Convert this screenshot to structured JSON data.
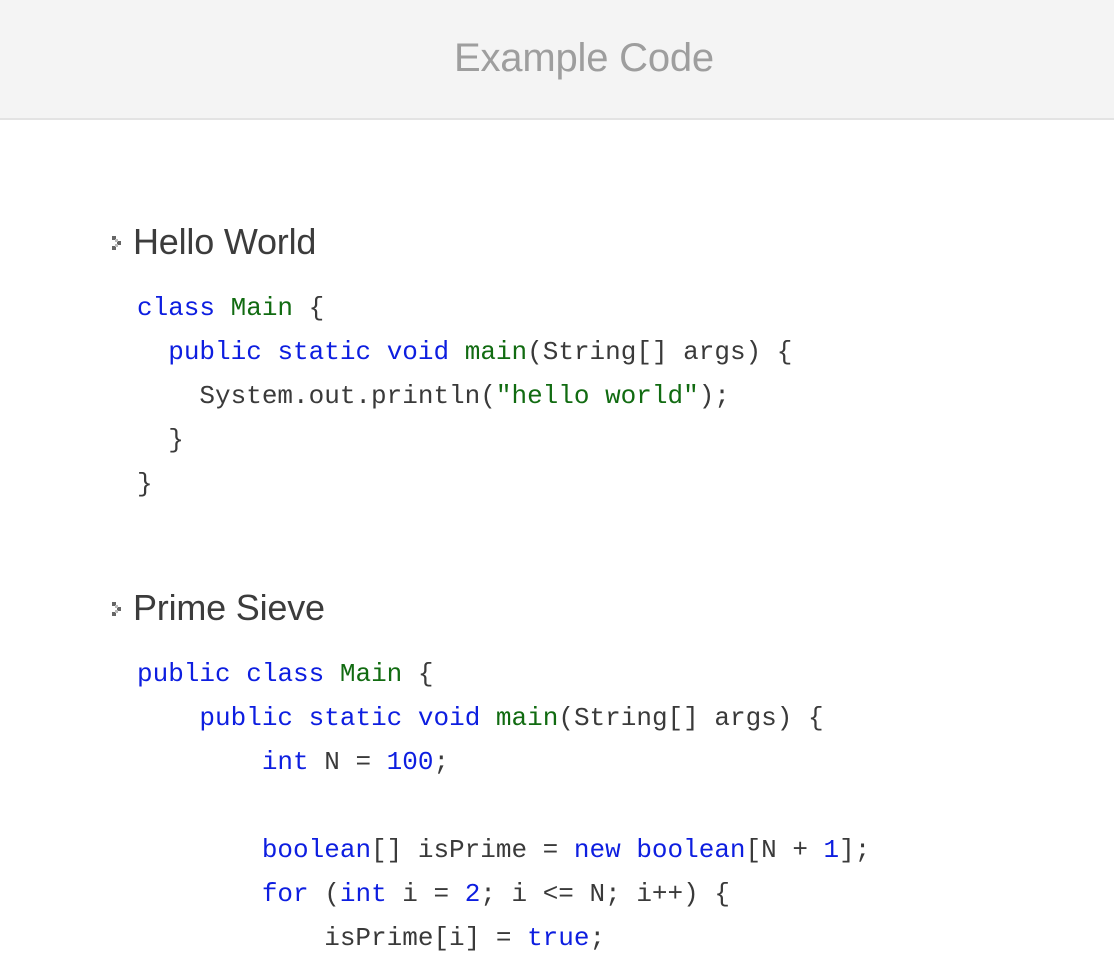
{
  "header": {
    "title": "Example Code"
  },
  "sections": [
    {
      "title": "Hello World",
      "icon": "expand-arrow-icon",
      "lines": [
        [
          {
            "t": "class",
            "c": "kw"
          },
          {
            "t": " ",
            "c": "pl"
          },
          {
            "t": "Main",
            "c": "ty"
          },
          {
            "t": " {",
            "c": "pl"
          }
        ],
        [
          {
            "t": "  ",
            "c": "pl"
          },
          {
            "t": "public",
            "c": "kw"
          },
          {
            "t": " ",
            "c": "pl"
          },
          {
            "t": "static",
            "c": "kw"
          },
          {
            "t": " ",
            "c": "pl"
          },
          {
            "t": "void",
            "c": "kw"
          },
          {
            "t": " ",
            "c": "pl"
          },
          {
            "t": "main",
            "c": "ty"
          },
          {
            "t": "(String[] args) {",
            "c": "pl"
          }
        ],
        [
          {
            "t": "    System.out.println(",
            "c": "pl"
          },
          {
            "t": "\"hello world\"",
            "c": "st"
          },
          {
            "t": ");",
            "c": "pl"
          }
        ],
        [
          {
            "t": "  }",
            "c": "pl"
          }
        ],
        [
          {
            "t": "}",
            "c": "pl"
          }
        ]
      ]
    },
    {
      "title": "Prime Sieve",
      "icon": "expand-arrow-icon",
      "lines": [
        [
          {
            "t": "public",
            "c": "kw"
          },
          {
            "t": " ",
            "c": "pl"
          },
          {
            "t": "class",
            "c": "kw"
          },
          {
            "t": " ",
            "c": "pl"
          },
          {
            "t": "Main",
            "c": "ty"
          },
          {
            "t": " {",
            "c": "pl"
          }
        ],
        [
          {
            "t": "    ",
            "c": "pl"
          },
          {
            "t": "public",
            "c": "kw"
          },
          {
            "t": " ",
            "c": "pl"
          },
          {
            "t": "static",
            "c": "kw"
          },
          {
            "t": " ",
            "c": "pl"
          },
          {
            "t": "void",
            "c": "kw"
          },
          {
            "t": " ",
            "c": "pl"
          },
          {
            "t": "main",
            "c": "ty"
          },
          {
            "t": "(String[] args) {",
            "c": "pl"
          }
        ],
        [
          {
            "t": "        ",
            "c": "pl"
          },
          {
            "t": "int",
            "c": "kw"
          },
          {
            "t": " N = ",
            "c": "pl"
          },
          {
            "t": "100",
            "c": "num"
          },
          {
            "t": ";",
            "c": "pl"
          }
        ],
        [],
        [
          {
            "t": "        ",
            "c": "pl"
          },
          {
            "t": "boolean",
            "c": "kw"
          },
          {
            "t": "[] isPrime = ",
            "c": "pl"
          },
          {
            "t": "new",
            "c": "kw"
          },
          {
            "t": " ",
            "c": "pl"
          },
          {
            "t": "boolean",
            "c": "kw"
          },
          {
            "t": "[N + ",
            "c": "pl"
          },
          {
            "t": "1",
            "c": "num"
          },
          {
            "t": "];",
            "c": "pl"
          }
        ],
        [
          {
            "t": "        ",
            "c": "pl"
          },
          {
            "t": "for",
            "c": "kw"
          },
          {
            "t": " (",
            "c": "pl"
          },
          {
            "t": "int",
            "c": "kw"
          },
          {
            "t": " i = ",
            "c": "pl"
          },
          {
            "t": "2",
            "c": "num"
          },
          {
            "t": "; i <= N; i++) {",
            "c": "pl"
          }
        ],
        [
          {
            "t": "            isPrime[i] = ",
            "c": "pl"
          },
          {
            "t": "true",
            "c": "kw"
          },
          {
            "t": ";",
            "c": "pl"
          }
        ]
      ]
    }
  ]
}
